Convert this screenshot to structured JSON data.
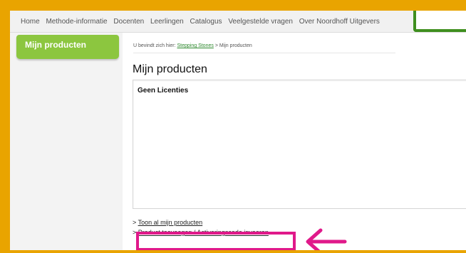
{
  "topnav": {
    "items": [
      "Home",
      "Methode-informatie",
      "Docenten",
      "Leerlingen",
      "Catalogus",
      "Veelgestelde vragen",
      "Over Noordhoff Uitgevers"
    ]
  },
  "sidebar": {
    "active_tab": "Mijn producten"
  },
  "breadcrumb": {
    "prefix": "U bevindt zich hier:",
    "link": "Stepping Stones",
    "separator": ">",
    "current": "Mijn producten"
  },
  "main": {
    "title": "Mijn producten",
    "empty_message": "Geen Licenties",
    "link_prefix": ">",
    "show_all_label": "Toon al mijn producten",
    "add_product_label": "Product toevoegen / Activeringscode invoeren"
  },
  "colors": {
    "frame": "#e9a400",
    "sidebar_tab": "#8cc63f",
    "highlight": "#e0198a",
    "accent_box": "#3f8f1f"
  },
  "annotations": {
    "arrow_icon": "left-arrow-icon"
  }
}
